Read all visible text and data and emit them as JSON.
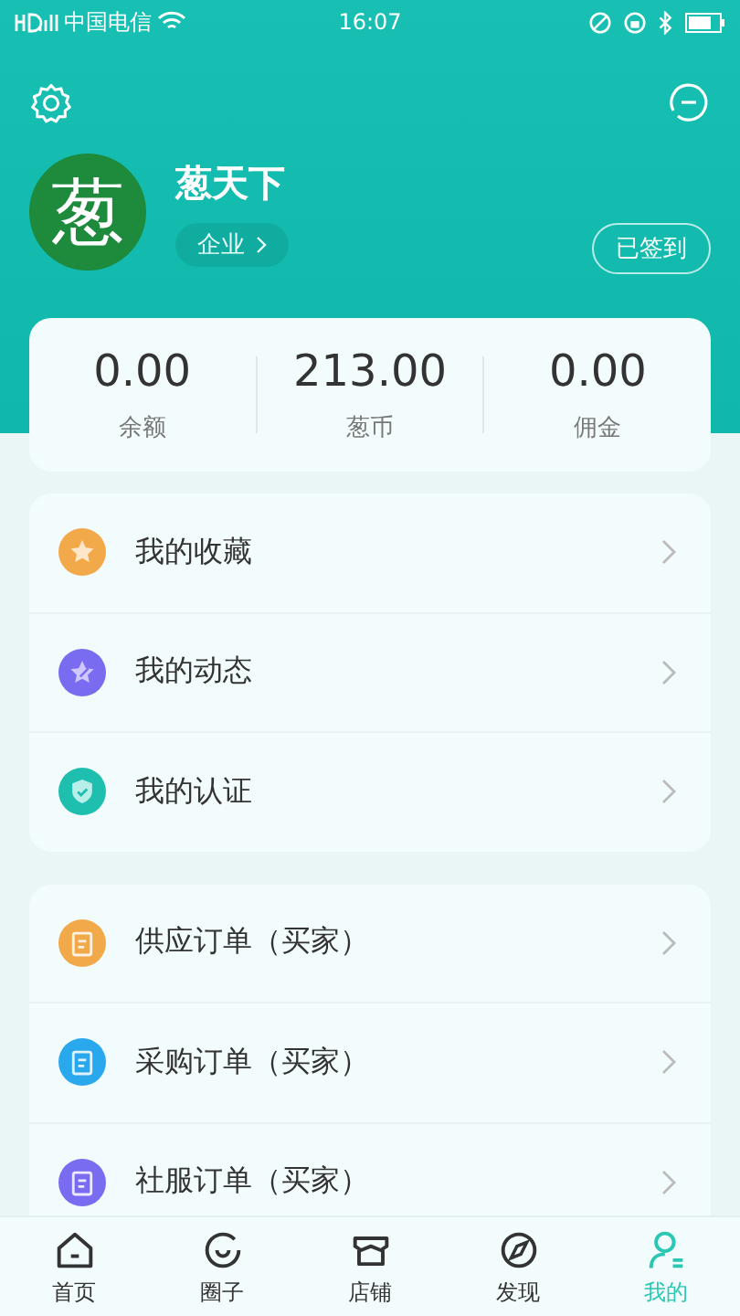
{
  "status_bar": {
    "carrier": "中国电信",
    "time": "16:07"
  },
  "profile": {
    "avatar_text": "葱",
    "name": "葱天下",
    "badge": "企业",
    "sign_button": "已签到"
  },
  "stats": [
    {
      "value": "0.00",
      "label": "余额"
    },
    {
      "value": "213.00",
      "label": "葱币"
    },
    {
      "value": "0.00",
      "label": "佣金"
    }
  ],
  "menu_groups": [
    [
      {
        "label": "我的收藏",
        "color": "#f2a94a"
      },
      {
        "label": "我的动态",
        "color": "#7a6cf0"
      },
      {
        "label": "我的认证",
        "color": "#1fbfb0"
      }
    ],
    [
      {
        "label": "供应订单（买家）",
        "color": "#f2a94a"
      },
      {
        "label": "采购订单（买家）",
        "color": "#2aa8ee"
      },
      {
        "label": "社服订单（买家）",
        "color": "#7a6cf0"
      }
    ]
  ],
  "tab_bar": [
    {
      "label": "首页",
      "selected": false
    },
    {
      "label": "圈子",
      "selected": false
    },
    {
      "label": "店铺",
      "selected": false
    },
    {
      "label": "发现",
      "selected": false
    },
    {
      "label": "我的",
      "selected": true
    }
  ]
}
